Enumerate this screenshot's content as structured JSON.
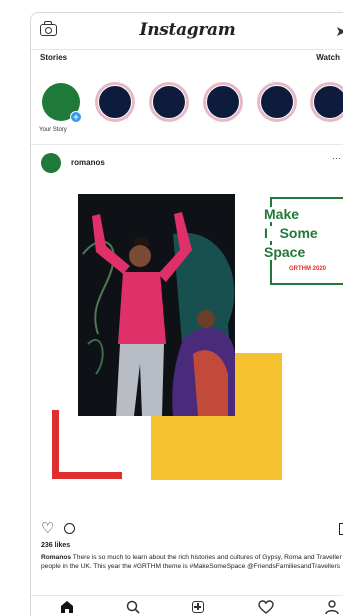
{
  "header": {
    "logo": "Instagram",
    "camera_icon": "camera-icon",
    "send_icon": "send-icon"
  },
  "stories": {
    "title": "Stories",
    "watch_all": "Watch",
    "own_label": "Your Story",
    "items_count_visible": 5,
    "ring_color": "#e8b8c6",
    "avatar_color": "#0d1b3d"
  },
  "post": {
    "username": "romanos",
    "avatar_color": "#1f7a3a",
    "image": {
      "headline_lines": [
        "Make",
        "Some",
        "Space"
      ],
      "tag": "GRTHM 2020",
      "colors": {
        "green": "#1f7a3a",
        "red": "#e0302e",
        "yellow": "#f6c12e"
      }
    },
    "likes": "236 likes",
    "caption_user": "Romanos",
    "caption_text": "There is so much to learn about the rich histories and cultures of Gypsy, Roma and Traveller people in the UK. This year the #GRTHM theme is #MakeSomeSpace @FriendsFamiliesandTravellers"
  },
  "nav": {
    "items": [
      "home-icon",
      "search-icon",
      "add-icon",
      "heart-icon",
      "profile-icon"
    ]
  }
}
